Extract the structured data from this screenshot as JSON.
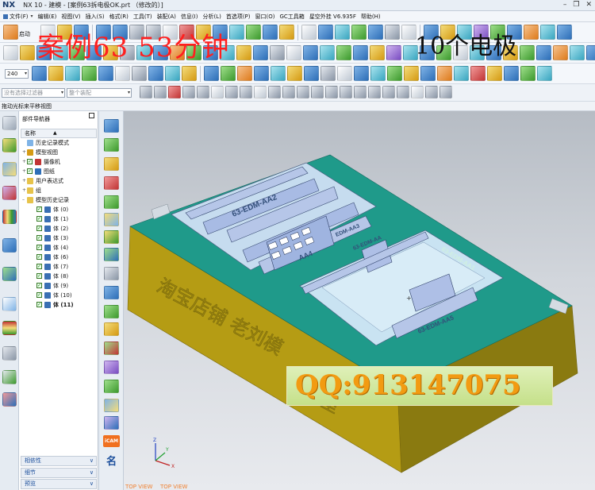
{
  "window": {
    "app_name": "NX",
    "title": "NX 10 - 建模 - [案例63拆电极OK.prt （修改的）]",
    "controls": [
      "–",
      "❐",
      "✕"
    ]
  },
  "menubar": {
    "items": [
      "文件(F)",
      "编辑(E)",
      "视图(V)",
      "插入(S)",
      "格式(R)",
      "工具(T)",
      "装配(A)",
      "信息(I)",
      "分析(L)",
      "首选项(P)",
      "窗口(O)",
      "GC工具箱",
      "星空外挂 V6.935F",
      "帮助(H)"
    ]
  },
  "toolbar": {
    "start_label": "启动",
    "zoom_value": "240",
    "filter_placeholder": "没有选择过滤器",
    "assembly_filter": "整个装配"
  },
  "overlay": {
    "case_title": "案例63  53分钟",
    "electrode_count": "10个电极",
    "qq_text": "QQ:913147075"
  },
  "hint": {
    "text": "拖动光标来平移视图"
  },
  "navigator": {
    "title": "部件导航器",
    "column_header": "名称",
    "tree": [
      {
        "label": "历史记录模式",
        "indent": 1,
        "icon": "clock-icon",
        "expander": ""
      },
      {
        "label": "模型视图",
        "indent": 1,
        "icon": "model-views-icon",
        "expander": "+"
      },
      {
        "label": "摄像机",
        "indent": 1,
        "icon": "camera-icon",
        "expander": "+",
        "checked": true
      },
      {
        "label": "图纸",
        "indent": 1,
        "icon": "drawing-icon",
        "expander": "+",
        "checked": true
      },
      {
        "label": "用户表达式",
        "indent": 1,
        "icon": "folder-icon",
        "expander": "+"
      },
      {
        "label": "组",
        "indent": 1,
        "icon": "folder-icon",
        "expander": "+"
      },
      {
        "label": "模型历史记录",
        "indent": 1,
        "icon": "folder-icon",
        "expander": "–"
      },
      {
        "label": "体 (0)",
        "indent": 3,
        "icon": "body-icon",
        "checked": true
      },
      {
        "label": "体 (1)",
        "indent": 3,
        "icon": "body-icon",
        "checked": true
      },
      {
        "label": "体 (2)",
        "indent": 3,
        "icon": "body-icon",
        "checked": true
      },
      {
        "label": "体 (3)",
        "indent": 3,
        "icon": "body-icon",
        "checked": true
      },
      {
        "label": "体 (4)",
        "indent": 3,
        "icon": "body-icon",
        "checked": true
      },
      {
        "label": "体 (6)",
        "indent": 3,
        "icon": "body-icon",
        "checked": true
      },
      {
        "label": "体 (7)",
        "indent": 3,
        "icon": "body-icon",
        "checked": true
      },
      {
        "label": "体 (8)",
        "indent": 3,
        "icon": "body-icon",
        "checked": true
      },
      {
        "label": "体 (9)",
        "indent": 3,
        "icon": "body-icon",
        "checked": true
      },
      {
        "label": "体 (10)",
        "indent": 3,
        "icon": "body-icon",
        "checked": true
      },
      {
        "label": "体 (11)",
        "indent": 3,
        "icon": "body-icon",
        "checked": true,
        "bold": true
      }
    ],
    "bottom_panels": [
      "相依性",
      "细节",
      "预览"
    ]
  },
  "vstrip": {
    "icam_label": "iCAM",
    "ming_label": "名"
  },
  "viewport": {
    "watermark_left": "淘宝店铺  老刘模",
    "watermark_right": "作室",
    "electrode_text_1": "63-EDM-AA2",
    "electrode_text_2": "AA4",
    "electrode_text_3": "63-EDM-AA5",
    "electrode_text_4": "EDM-AA3",
    "electrode_text_5": "63-EDM-AA",
    "electrode_text_6": "63-EDM-AA1",
    "view_label_1": "TOP VIEW",
    "view_label_2": "TOP VIEW",
    "axis_labels": [
      "X",
      "Y",
      "Z"
    ],
    "colors": {
      "top_face": "#1f9a8a",
      "side_face": "#b79a12",
      "front_face": "#a8930f",
      "pocket": "#c6dcef",
      "wall": "#b6c6e8"
    }
  }
}
